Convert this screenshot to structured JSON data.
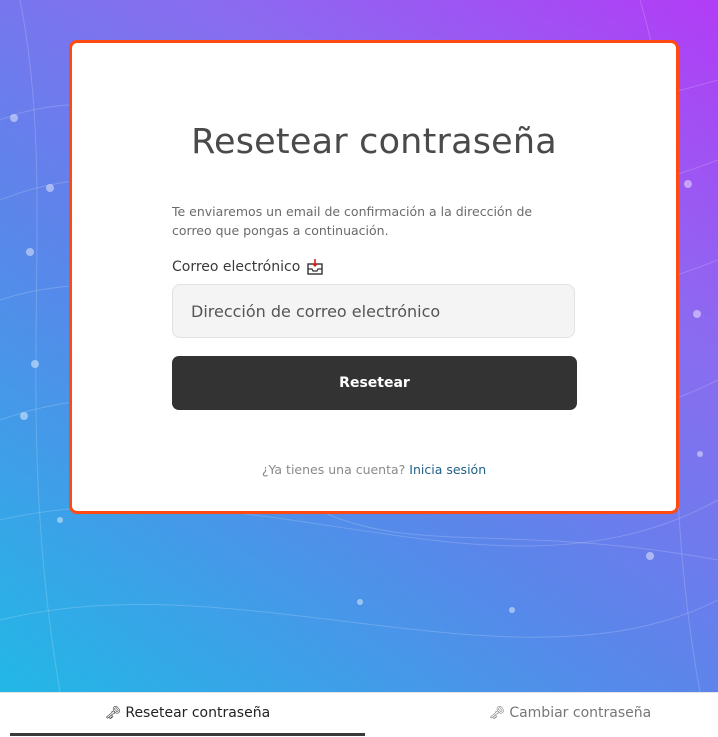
{
  "card": {
    "title": "Resetear contraseña",
    "description": "Te enviaremos un email de confirmación a la dirección de correo que pongas a continuación.",
    "email_label": "Correo electrónico",
    "email_placeholder": "Dirección de correo electrónico",
    "submit_label": "Resetear",
    "login_prompt": "¿Ya tienes una cuenta?",
    "login_link": "Inicia sesión"
  },
  "tabs": [
    {
      "label": "Resetear contraseña",
      "icon": "key-icon",
      "active": true
    },
    {
      "label": "Cambiar contraseña",
      "icon": "key-icon",
      "active": false
    }
  ],
  "colors": {
    "card_border": "#ff4a12",
    "button_bg": "#333333",
    "link": "#1f5f86",
    "bg_start": "#22b8e6",
    "bg_end": "#b23cf6"
  }
}
